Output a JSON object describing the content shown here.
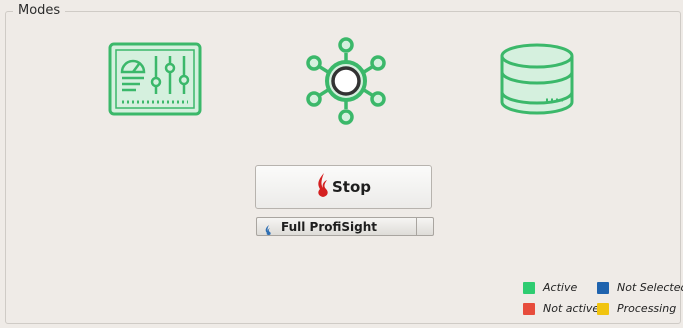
{
  "modes": {
    "group_title": "Modes",
    "icons": [
      "dashboard-icon",
      "network-hub-icon",
      "database-icon"
    ],
    "accent_color": "#3bb86a",
    "stop_button": {
      "label": "Stop",
      "icon": "flame-logo-icon"
    },
    "mode_select": {
      "value": "Full ProfiSight",
      "icon": "flame-small-icon"
    },
    "legend": [
      {
        "label": "Active",
        "color": "#2ecc71"
      },
      {
        "label": "Not Selected",
        "color": "#1f63ae"
      },
      {
        "label": "Not active",
        "color": "#e74c3c"
      },
      {
        "label": "Processing",
        "color": "#f1c40f"
      }
    ]
  }
}
